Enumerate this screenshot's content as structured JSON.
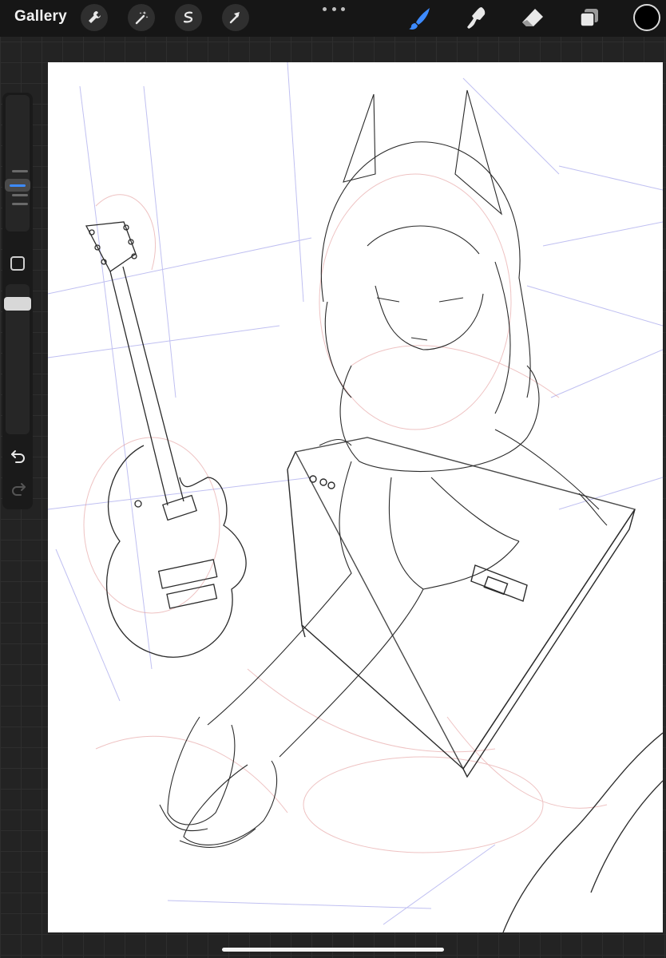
{
  "topbar": {
    "gallery_label": "Gallery",
    "left_tools": [
      "wrench-icon",
      "magic-wand-icon",
      "selection-icon",
      "transform-arrow-icon"
    ],
    "right_tools": [
      "brush-icon",
      "smudge-icon",
      "eraser-icon",
      "layers-icon"
    ],
    "active_tool": "brush-icon",
    "current_color": "#000000",
    "accent_color": "#3d8bff"
  },
  "sidebar": {
    "brush_size_label": "",
    "opacity_label": "",
    "controls": [
      "brush-size-slider",
      "modify-button",
      "opacity-slider",
      "undo-icon",
      "redo-icon"
    ]
  },
  "canvas": {
    "subject": "",
    "sketch_colors": [
      "#222222",
      "#8080e0",
      "#e08080"
    ]
  }
}
